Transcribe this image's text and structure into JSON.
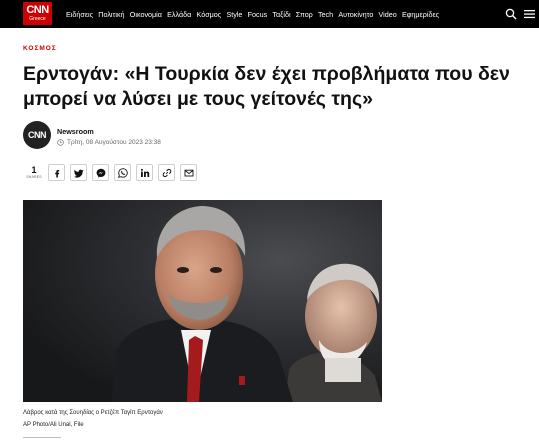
{
  "header": {
    "logo_text": "CNN",
    "logo_subtext": "Greece",
    "nav": [
      "Ειδήσεις",
      "Πολιτική",
      "Οικονομία",
      "Ελλάδα",
      "Κόσμος",
      "Style",
      "Focus",
      "Ταξίδι",
      "Σπορ",
      "Tech",
      "Αυτοκίνητο",
      "Video",
      "Εφημερίδες"
    ],
    "icons": [
      "search-icon",
      "menu-icon"
    ]
  },
  "article": {
    "section": "ΚΟΣΜΟΣ",
    "title": "Ερντογάν: «Η Τουρκία δεν έχει προβλήματα που δεν μπορεί να λύσει με τους γείτονές της»",
    "author_avatar_text": "CNN",
    "author": "Newsroom",
    "date": "Τρίτη, 08 Αυγούστου 2023 23:38",
    "share_count": "1",
    "share_label": "SHARES",
    "share_icons": [
      "facebook-icon",
      "twitter-icon",
      "messenger-icon",
      "whatsapp-icon",
      "linkedin-icon",
      "link-icon",
      "email-icon"
    ],
    "photo_caption": "Λάβρος κατά της Σουηδίας ο Ρετζέπ Ταγίπ Ερντογάν",
    "photo_credit": "AP Photo/Ali Unal, File"
  },
  "colors": {
    "brand_red": "#cc0000",
    "topbar": "#000000"
  }
}
